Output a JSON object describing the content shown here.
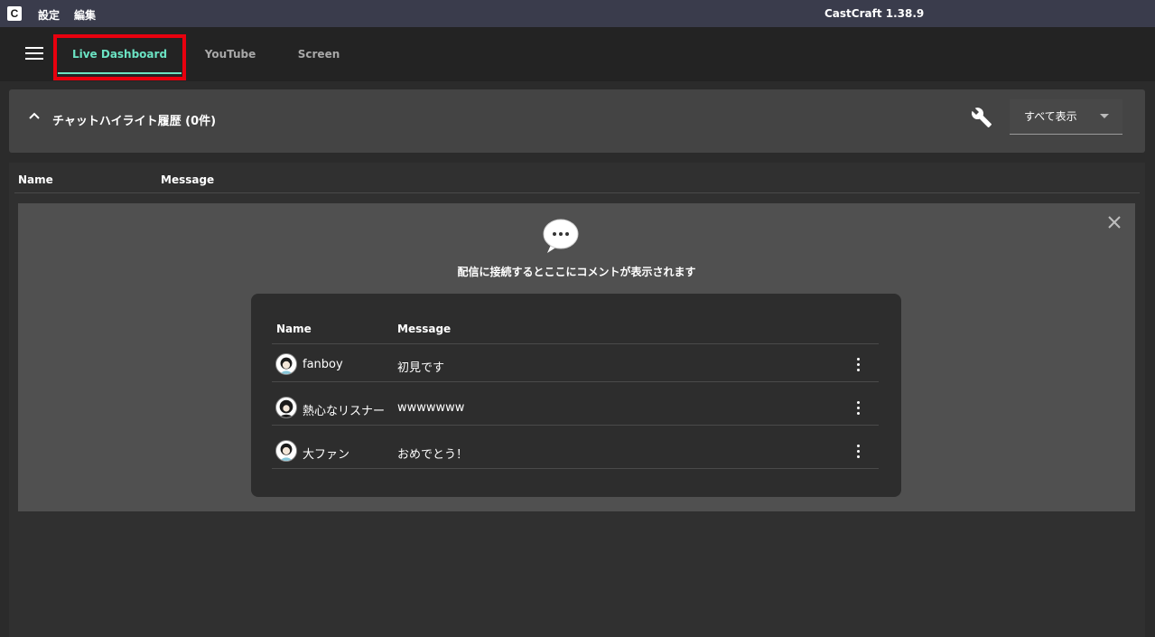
{
  "window": {
    "title": "CastCraft 1.38.9",
    "menu": [
      "設定",
      "編集"
    ]
  },
  "nav": {
    "tabs": [
      {
        "label": "Live Dashboard",
        "active": true
      },
      {
        "label": "YouTube",
        "active": false
      },
      {
        "label": "Screen",
        "active": false
      }
    ]
  },
  "history": {
    "title": "チャットハイライト履歴 (0件)",
    "filter": "すべて表示"
  },
  "table": {
    "columns": [
      "Name",
      "Message"
    ]
  },
  "empty_state": {
    "message": "配信に接続するとここにコメントが表示されます",
    "sample": {
      "columns": [
        "Name",
        "Message"
      ],
      "rows": [
        {
          "name": "fanboy",
          "message": "初見です"
        },
        {
          "name": "熱心なリスナー",
          "message": "wwwwwww"
        },
        {
          "name": "大ファン",
          "message": "おめでとう！"
        }
      ]
    }
  },
  "colors": {
    "accent": "#6be3c3",
    "highlight_border": "#e8000e",
    "titlebar": "#3a3c4c"
  },
  "icons": [
    "app-logo-icon",
    "hamburger-icon",
    "chevron-up-icon",
    "wrench-icon",
    "chevron-down-icon",
    "close-icon",
    "chat-bubble-icon",
    "more-vert-icon"
  ]
}
